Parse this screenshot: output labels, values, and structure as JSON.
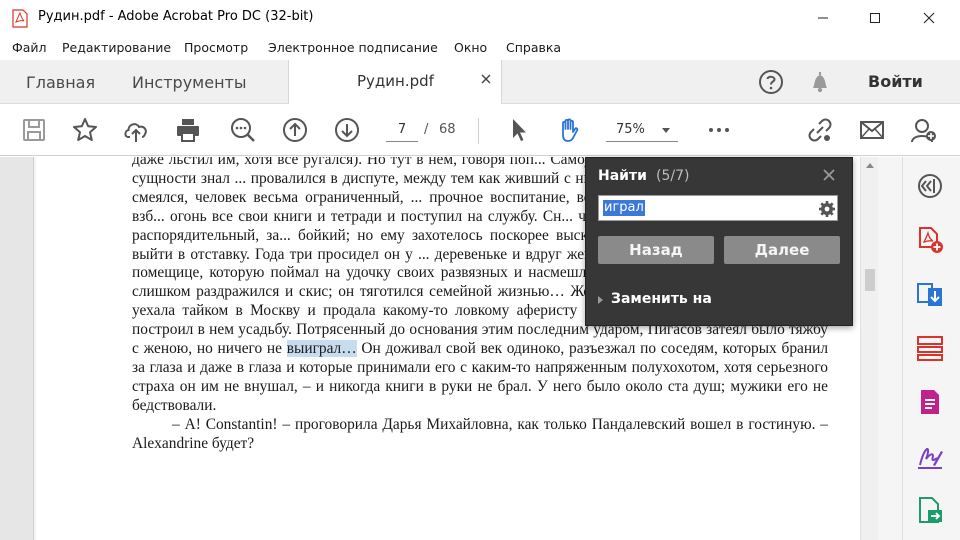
{
  "window": {
    "title": "Рудин.pdf - Adobe Acrobat Pro DC (32-bit)",
    "app_icon": "pdf-icon",
    "controls": [
      "minimize-icon",
      "maximize-icon",
      "close-icon"
    ]
  },
  "menu": {
    "items": [
      "Файл",
      "Редактирование",
      "Просмотр",
      "Электронное подписание",
      "Окно",
      "Справка"
    ]
  },
  "tabs": {
    "home": "Главная",
    "tools": "Инструменты",
    "document": "Рудин.pdf",
    "signin": "Войти",
    "icons": [
      "help-icon",
      "bell-icon"
    ]
  },
  "toolbar": {
    "page_current": "7",
    "page_sep": "/",
    "page_total": "68",
    "zoom": "75%",
    "icons": [
      "save-icon",
      "bookmark-star-icon",
      "upload-cloud-icon",
      "print-icon",
      "search-zoom-icon",
      "page-up-icon",
      "page-down-icon",
      "select-arrow-icon",
      "hand-icon",
      "more-icon",
      "share-link-icon",
      "email-icon",
      "add-user-icon"
    ]
  },
  "document": {
    "paragraph1": {
      "before": "даже льстил им, хотя все ругался). Но тут в нем, говоря поп... Самоучка не из любви к науке, Пигасов в сущности знал ... провалился в диспуте, между тем как живший с ним в одной ... которым он постоянно смеялся, человек весьма ограниченный, ... прочное воспитание, восторгествовал вполне. Неудача эта взб... огонь все свои книги и тетради и поступил на службу. Сн... чиновник он был хоть куда, не очень распорядительный, за... бойкий; но ему захотелось поскорее выскочить в люди – ... принужден был выйти в отставку. Года три просидел он у ... деревеньке и вдруг женился на богатой, полуобразованной помещице, которую поймал на удочку своих развязных и насмешливых манер. Но нрав Пигасова уже слишком раздражился и скис; он тяготился семейной жизнью… Жена его, пожив с ним несколько лет, уехала тайком в Москву и продала какому-то ловкому аферисту свое имение, а Пигасов только что построил в нем усадьбу. Потрясенный до основания этим последним ударом, Пигасов затеял было тяжбу с женою, но ничего не ",
      "highlight": "выиграл…",
      "after": " Он доживал свой век одиноко, разъезжал по соседям, которых бранил за глаза и даже в глаза и которые принимали его с каким-то напряженным полухохотом, хотя серьезного страха он им не внушал, – и никогда книги в руки не брал. У него было около ста душ; мужики его не бедствовали."
    },
    "paragraph2": "– А! Constantin! – проговорила Дарья Михайловна, как только Пандалевский вошел в гостиную. – Alexandrine будет?"
  },
  "find": {
    "title": "Найти",
    "count": "(5/7)",
    "query": "играл",
    "prev": "Назад",
    "next": "Далее",
    "replace": "Заменить на"
  },
  "right_panel": {
    "icons": [
      "compare-icon",
      "create-pdf-icon",
      "export-pdf-icon",
      "organize-pages-icon",
      "edit-pdf-icon",
      "fill-sign-icon",
      "export-arrow-icon"
    ]
  },
  "colors": {
    "acrobat_red": "#d9342b",
    "tool_blue": "#2a74d6",
    "find_panel": "#373737",
    "highlight": "#c8dcf0"
  }
}
